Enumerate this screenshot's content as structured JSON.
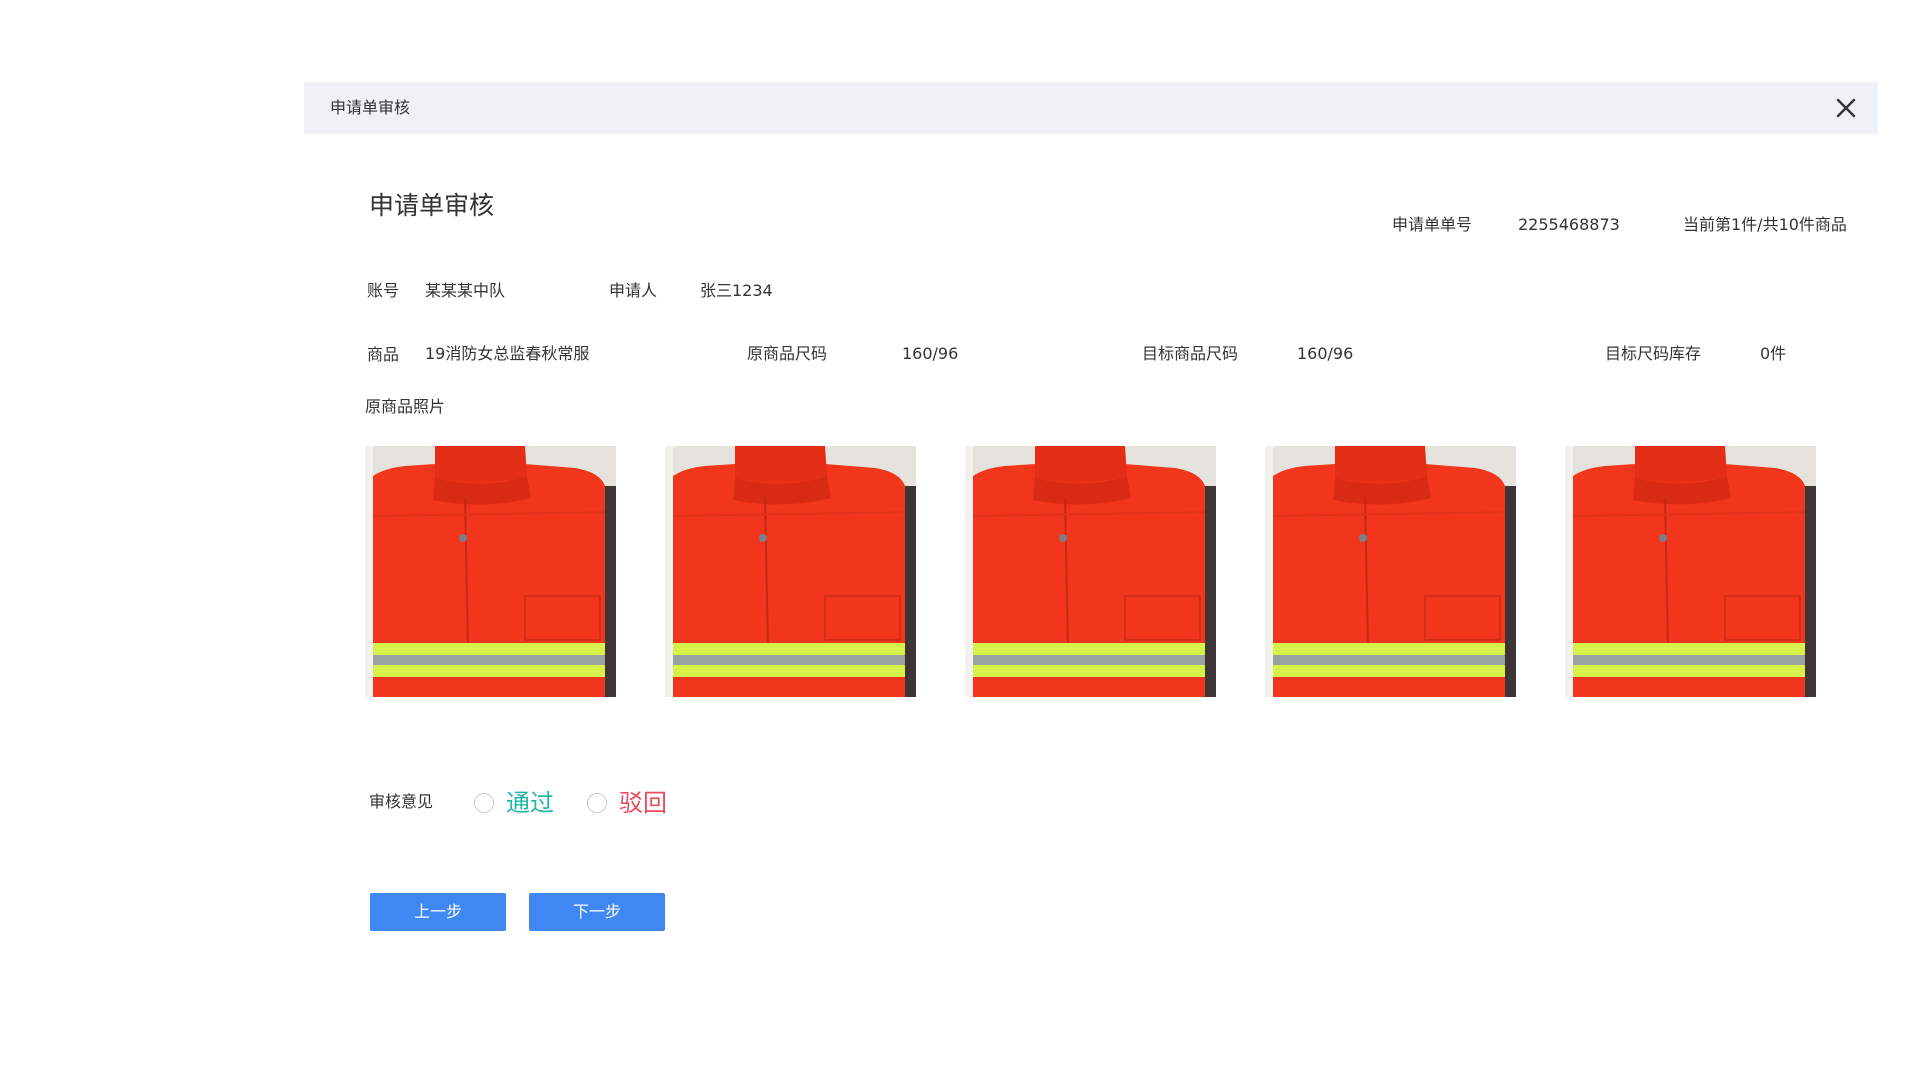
{
  "dialog": {
    "header_title": "申请单审核",
    "close_icon": "close-icon"
  },
  "page": {
    "title": "申请单审核"
  },
  "order": {
    "number_label": "申请单单号",
    "number_value": "2255468873",
    "progress_text": "当前第1件/共10件商品"
  },
  "info": {
    "account_label": "账号",
    "account_value": "某某某中队",
    "applicant_label": "申请人",
    "applicant_value": "张三1234",
    "product_label": "商品",
    "product_value": "19消防女总监春秋常服",
    "orig_size_label": "原商品尺码",
    "orig_size_value": "160/96",
    "target_size_label": "目标商品尺码",
    "target_size_value": "160/96",
    "target_stock_label": "目标尺码库存",
    "target_stock_value": "0件"
  },
  "photos": {
    "title": "原商品照片",
    "items": [
      "product-photo",
      "product-photo",
      "product-photo",
      "product-photo",
      "product-photo"
    ]
  },
  "review": {
    "label": "审核意见",
    "options": [
      {
        "label": "通过",
        "color": "#20b8a4",
        "selected": false
      },
      {
        "label": "驳回",
        "color": "#e84a5f",
        "selected": false
      }
    ]
  },
  "buttons": {
    "prev_label": "上一步",
    "next_label": "下一步"
  },
  "colors": {
    "header_bg": "#eef1f5",
    "primary": "#3f87f2",
    "pass": "#20b8a4",
    "reject": "#e84a5f"
  }
}
